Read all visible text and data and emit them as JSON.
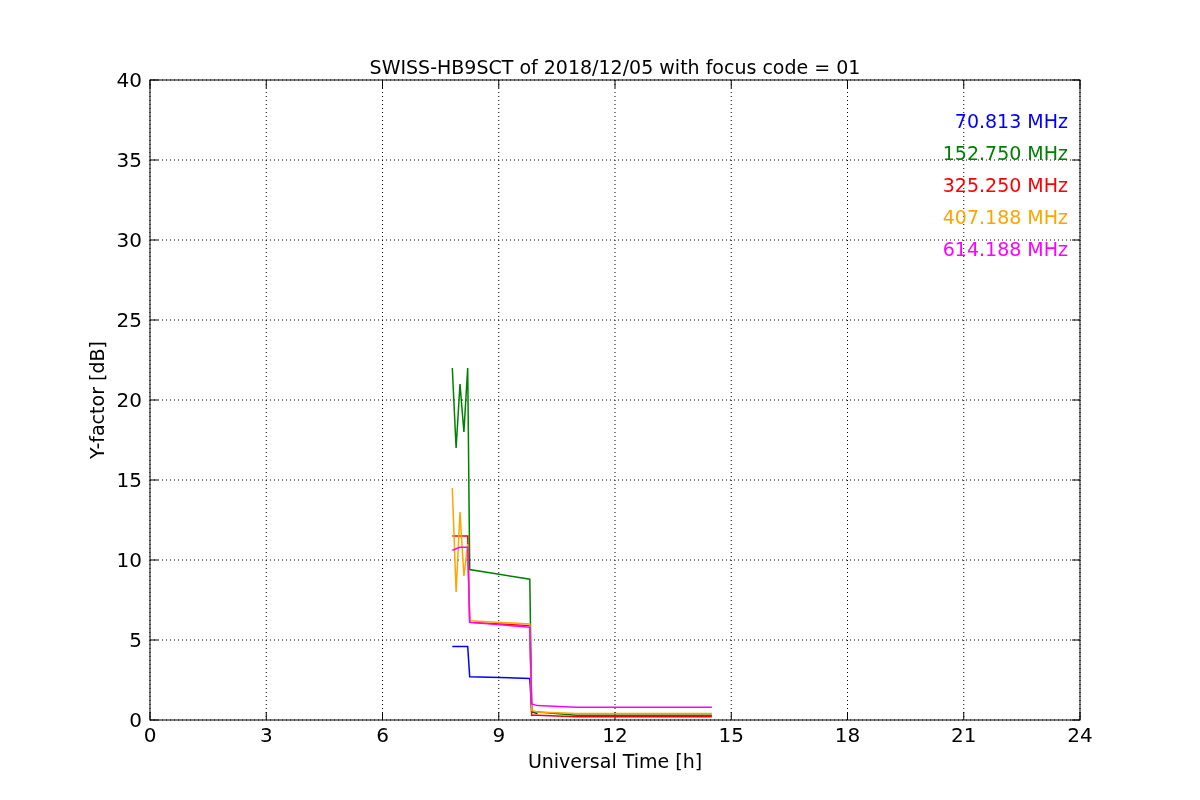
{
  "chart_data": {
    "type": "line",
    "title": "SWISS-HB9SCT of 2018/12/05 with focus code = 01",
    "xlabel": "Universal Time [h]",
    "ylabel": "Y-factor [dB]",
    "x": [
      7.8,
      7.9,
      8.0,
      8.1,
      8.2,
      8.25,
      9.8,
      9.85,
      10,
      11,
      12,
      13,
      14,
      14.5
    ],
    "series": [
      {
        "name": "70.813 MHz",
        "color": "#0000ff",
        "values": [
          4.6,
          4.6,
          4.6,
          4.6,
          4.6,
          2.7,
          2.6,
          0.5,
          0.4,
          null,
          null,
          null,
          null,
          null
        ]
      },
      {
        "name": "152.750 MHz",
        "color": "#008000",
        "values": [
          22,
          17,
          21,
          18,
          22,
          9.4,
          8.8,
          0.5,
          0.5,
          0.3,
          0.3,
          0.3,
          0.3,
          0.3
        ]
      },
      {
        "name": "325.250 MHz",
        "color": "#ff0000",
        "values": [
          11.5,
          11.5,
          11.5,
          11.5,
          11.5,
          6.1,
          5.9,
          0.3,
          0.3,
          0.2,
          0.2,
          0.2,
          0.2,
          0.2
        ]
      },
      {
        "name": "407.188 MHz",
        "color": "#ffa500",
        "values": [
          14.5,
          8,
          13,
          9,
          11,
          6.2,
          6.0,
          0.6,
          0.5,
          0.4,
          0.4,
          0.4,
          0.4,
          0.4
        ]
      },
      {
        "name": "614.188 MHz",
        "color": "#ff00ff",
        "values": [
          10.6,
          10.7,
          10.8,
          10.8,
          10.8,
          6.1,
          5.8,
          1.0,
          0.9,
          0.8,
          0.8,
          0.8,
          0.8,
          0.8
        ]
      }
    ],
    "grid": true,
    "xlim": [
      0,
      24
    ],
    "ylim": [
      0,
      40
    ],
    "xticks": [
      0,
      3,
      6,
      9,
      12,
      15,
      18,
      21,
      24
    ],
    "yticks": [
      0,
      5,
      10,
      15,
      20,
      25,
      30,
      35,
      40
    ]
  }
}
